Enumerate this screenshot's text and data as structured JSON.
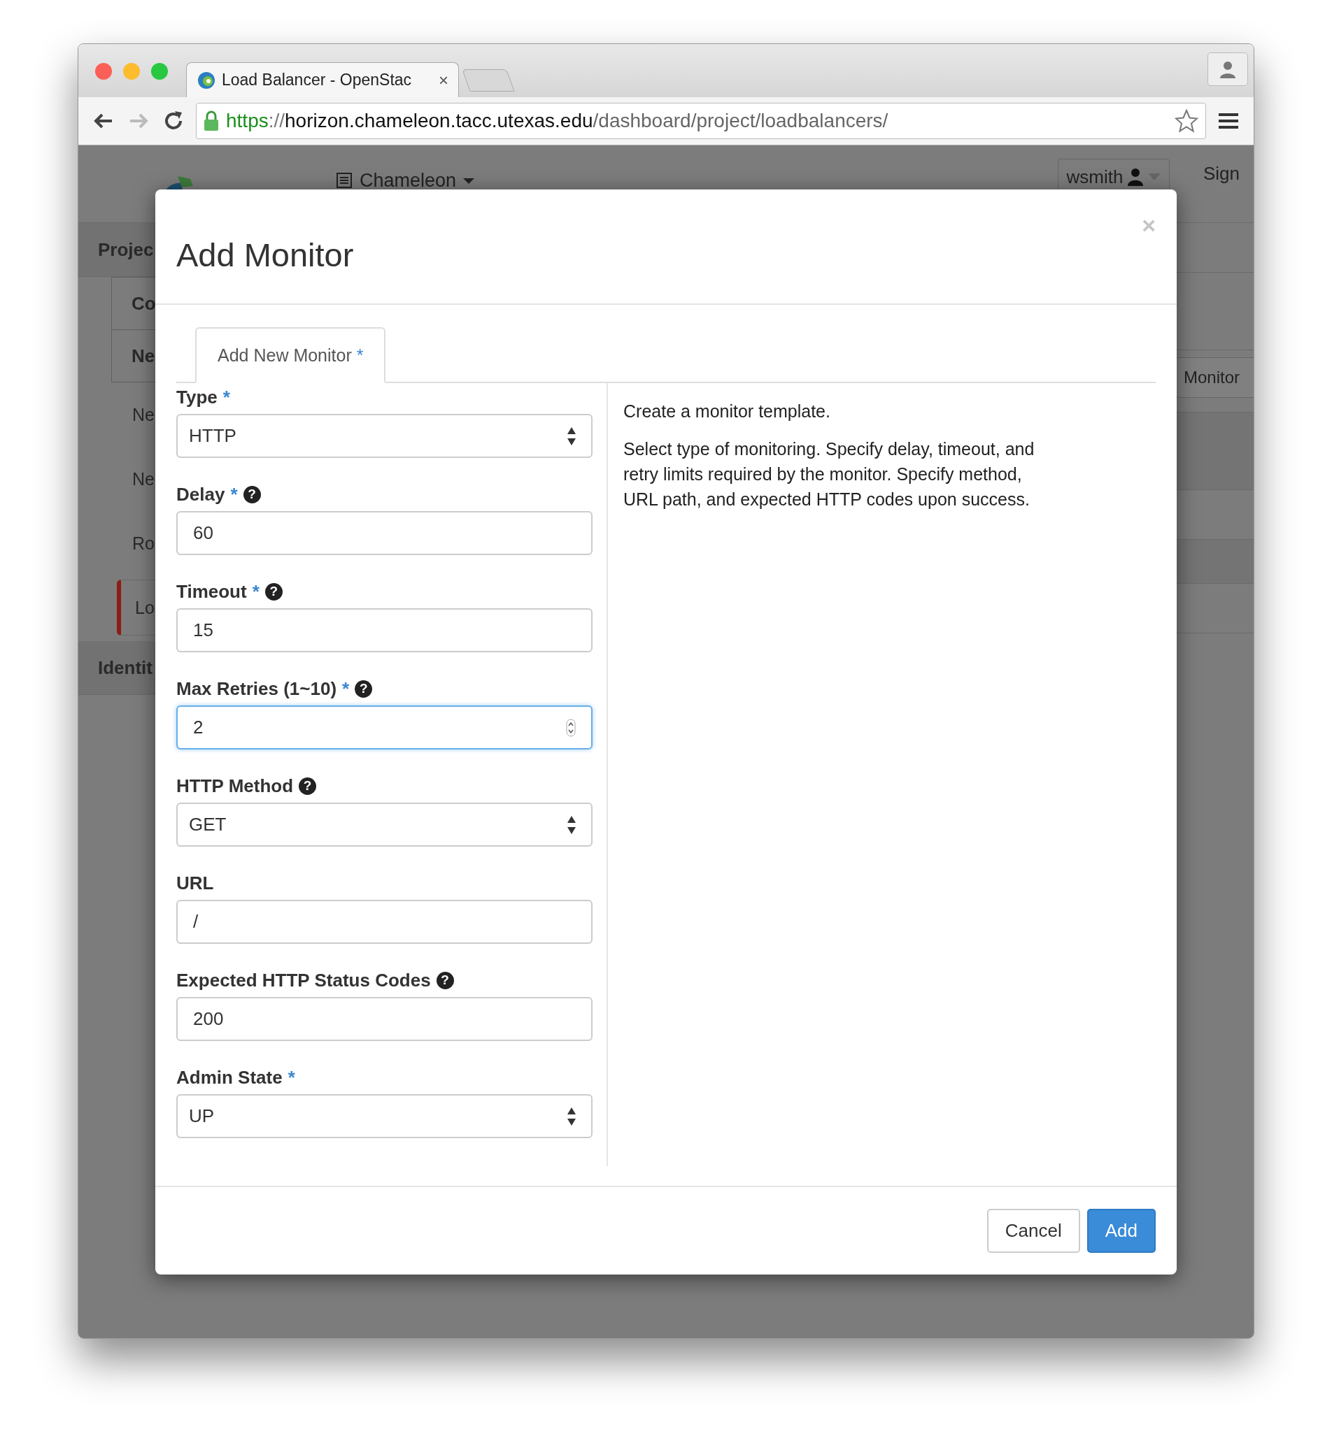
{
  "browser": {
    "tab_title": "Load Balancer - OpenStac",
    "tab_close": "×",
    "url": {
      "scheme": "https",
      "separator": "://",
      "host": "horizon.chameleon.tacc.utexas.edu",
      "path": "/dashboard/project/loadbalancers/"
    }
  },
  "page": {
    "project_menu": "Chameleon",
    "user_menu": "wsmith",
    "sign_out": "Sign",
    "sidebar": [
      {
        "label": "Projec",
        "kind": "section",
        "selected": false
      },
      {
        "label": "Co",
        "kind": "panel",
        "selected": false
      },
      {
        "label": "Ne",
        "kind": "panel",
        "selected": false
      },
      {
        "label": "Ne",
        "kind": "link",
        "selected": false
      },
      {
        "label": "Ne",
        "kind": "link",
        "selected": false
      },
      {
        "label": "Ro",
        "kind": "link",
        "selected": false
      },
      {
        "label": "Lo",
        "kind": "link",
        "selected": true
      },
      {
        "label": "Identit",
        "kind": "section",
        "selected": false
      }
    ],
    "action_button": "Monitor"
  },
  "modal": {
    "title": "Add Monitor",
    "close": "×",
    "tabs": [
      {
        "label": "Add New Monitor",
        "mark": "*",
        "selected": true
      }
    ],
    "fields": [
      {
        "label": "Type",
        "mark": "*",
        "kind": "select",
        "value": "HTTP",
        "focused": false
      },
      {
        "label": "Delay",
        "mark": "*",
        "help": "?",
        "kind": "text",
        "value": "60",
        "focused": false
      },
      {
        "label": "Timeout",
        "mark": "*",
        "help": "?",
        "kind": "text",
        "value": "15",
        "focused": false
      },
      {
        "label": "Max Retries (1~10)",
        "mark": "*",
        "help": "?",
        "kind": "number",
        "value": "2",
        "focused": true
      },
      {
        "label": "HTTP Method",
        "help": "?",
        "kind": "select",
        "value": "GET",
        "focused": false
      },
      {
        "label": "URL",
        "kind": "text",
        "value": "/",
        "focused": false
      },
      {
        "label": "Expected HTTP Status Codes",
        "help": "?",
        "kind": "text",
        "value": "200",
        "focused": false
      },
      {
        "label": "Admin State",
        "mark": "*",
        "kind": "select",
        "value": "UP",
        "focused": false
      }
    ],
    "description": [
      "Create a monitor template.",
      "Select type of monitoring. Specify delay, timeout, and retry limits required by the monitor. Specify method, URL path, and expected HTTP codes upon success."
    ],
    "buttons": [
      {
        "label": "Cancel",
        "kind": "default"
      },
      {
        "label": "Add",
        "kind": "primary"
      }
    ]
  }
}
